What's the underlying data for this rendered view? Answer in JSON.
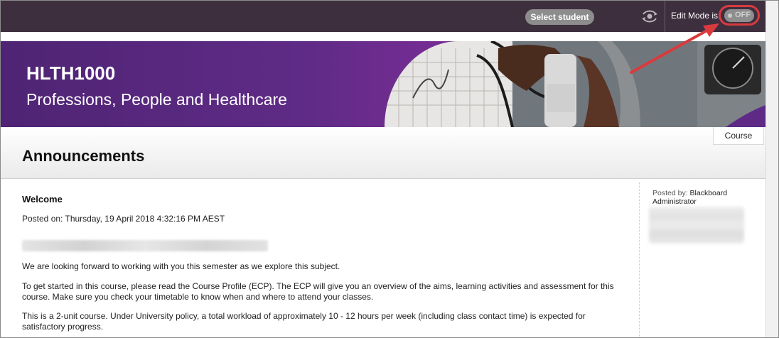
{
  "topbar": {
    "select_student_label": "Select student",
    "edit_mode_label": "Edit Mode is:",
    "edit_mode_state": "OFF",
    "background_color": "#3e2f3f",
    "highlight_color": "#d93a3e"
  },
  "banner": {
    "course_code": "HLTH1000",
    "course_name": "Professions, People and Healthcare",
    "gradient_colors": [
      "#4f2474",
      "#8f3a9e"
    ]
  },
  "tabs": {
    "course_label": "Course"
  },
  "page": {
    "title": "Announcements"
  },
  "announcement": {
    "title": "Welcome",
    "posted_on": "Posted on: Thursday, 19 April 2018 4:32:16 PM AEST",
    "paragraphs": [
      "We are looking forward to working with you this semester as we explore this subject.",
      "To get started in this course, please read the Course Profile (ECP). The ECP will give you an overview of the aims, learning activities and assessment for this course. Make sure you check your timetable to know when and where to attend your classes.",
      "This is a 2-unit course. Under University policy, a total workload of approximately 10 - 12 hours per week (including class contact time) is expected for satisfactory progress."
    ],
    "posted_by_label": "Posted by:",
    "posted_by_name": "Blackboard Administrator"
  },
  "icons": {
    "student_preview": "eye-refresh-icon",
    "toggle_dot": "toggle-dot-icon"
  }
}
